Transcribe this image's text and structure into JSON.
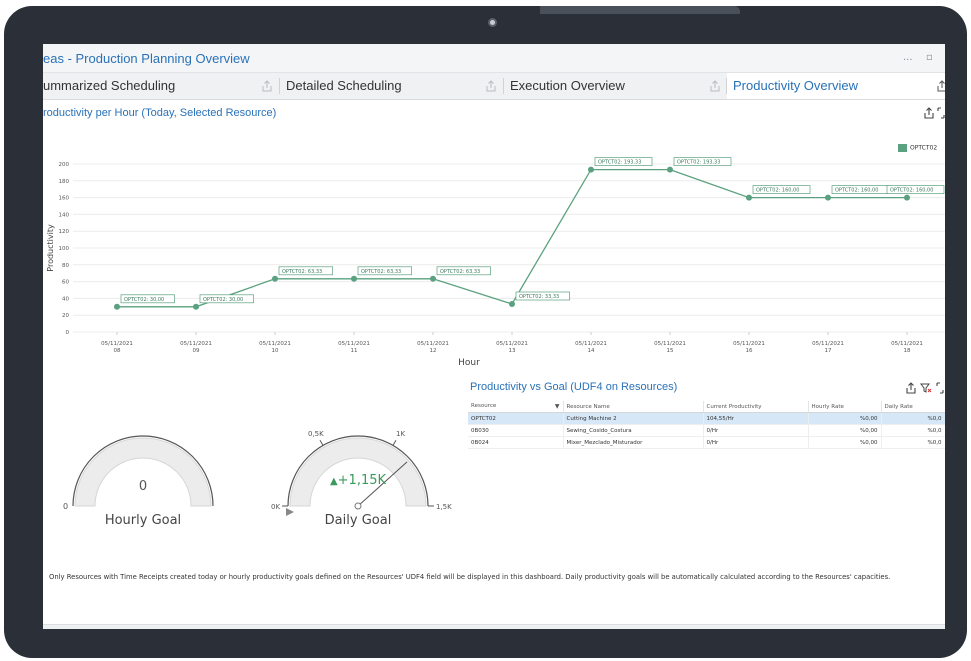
{
  "app": {
    "title": "eas - Production Planning Overview",
    "window_controls": [
      "...",
      "▫"
    ]
  },
  "tabs": [
    {
      "label": "ummarized Scheduling",
      "active": false
    },
    {
      "label": "Detailed Scheduling",
      "active": false
    },
    {
      "label": "Execution Overview",
      "active": false
    },
    {
      "label": "Productivity Overview",
      "active": true
    }
  ],
  "chart_section": {
    "title": "roductivity per Hour (Today, Selected Resource)",
    "icons": [
      "export-icon",
      "maximize-icon"
    ]
  },
  "chart_data": {
    "type": "line",
    "title": "",
    "xlabel": "Hour",
    "ylabel": "Productivity",
    "ylim": [
      0,
      200
    ],
    "yticks": [
      0,
      20,
      40,
      60,
      80,
      100,
      120,
      140,
      160,
      180,
      200
    ],
    "categories": [
      {
        "date": "05/11/2021",
        "hour": "08"
      },
      {
        "date": "05/11/2021",
        "hour": "09"
      },
      {
        "date": "05/11/2021",
        "hour": "10"
      },
      {
        "date": "05/11/2021",
        "hour": "11"
      },
      {
        "date": "05/11/2021",
        "hour": "12"
      },
      {
        "date": "05/11/2021",
        "hour": "13"
      },
      {
        "date": "05/11/2021",
        "hour": "14"
      },
      {
        "date": "05/11/2021",
        "hour": "15"
      },
      {
        "date": "05/11/2021",
        "hour": "16"
      },
      {
        "date": "05/11/2021",
        "hour": "17"
      },
      {
        "date": "05/11/2021",
        "hour": "18"
      }
    ],
    "series": [
      {
        "name": "OPTCT02",
        "color": "#5aa17f",
        "values": [
          30,
          30,
          63.33,
          63.33,
          63.33,
          33.33,
          193.33,
          193.33,
          160,
          160,
          160
        ],
        "labels": [
          "OPTCT02: 30,00",
          "OPTCT02: 30,00",
          "OPTCT02: 63,33",
          "OPTCT02: 63,33",
          "OPTCT02: 63,33",
          "OPTCT02: 33,33",
          "OPTCT02: 193,33",
          "OPTCT02: 193,33",
          "OPTCT02: 160,00",
          "OPTCT02: 160,00",
          "OPTCT02: 160,00"
        ]
      }
    ],
    "legend": "top-right",
    "grid": true
  },
  "gauges": {
    "hourly": {
      "label": "Hourly Goal",
      "value": "0",
      "min_label": "0",
      "fill": 0
    },
    "daily": {
      "label": "Daily Goal",
      "value": "+1,15K",
      "value_prefix": "▲",
      "tick_labels": [
        "0K",
        "0,5K",
        "1K",
        "1,5K"
      ],
      "needle_value": 1150,
      "max": 1500,
      "value_color": "#3a9a5c"
    }
  },
  "grid": {
    "title": "Productivity vs Goal (UDF4 on Resources)",
    "columns": [
      "Resource",
      "Resource Name",
      "Current Productivity",
      "Hourly Rate",
      "Daily Rate"
    ],
    "rows": [
      {
        "resource": "OPTCT02",
        "name": "Cutting Machine 2",
        "current": "104,55/Hr",
        "hourly": "%0,00",
        "daily": "%0,0",
        "selected": true
      },
      {
        "resource": "0B030",
        "name": "Sewing_Cosido_Costura",
        "current": "0/Hr",
        "hourly": "%0,00",
        "daily": "%0,0",
        "selected": false
      },
      {
        "resource": "0B024",
        "name": "Mixer_Mezclado_Misturador",
        "current": "0/Hr",
        "hourly": "%0,00",
        "daily": "%0,0",
        "selected": false
      }
    ],
    "icons": [
      "export-icon",
      "clear-filter-icon",
      "maximize-icon"
    ]
  },
  "footer": {
    "note": "Only Resources with Time Receipts created today or hourly productivity goals defined on the Resources' UDF4 field will be displayed in this dashboard. Daily productivity goals will be automatically calculated according to the Resources' capacities."
  },
  "colors": {
    "accent": "#2a72b8",
    "series": "#5aa17f",
    "bezel": "#2b3038"
  }
}
